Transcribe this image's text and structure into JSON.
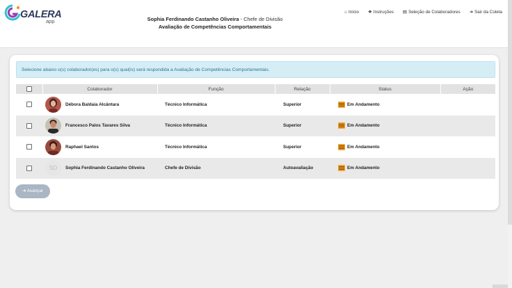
{
  "header": {
    "logo_text": "GALERA",
    "logo_sub": "app",
    "user_name": "Sophia Ferdinando Castanho Oliveira",
    "user_role": "Chefe de Divisão",
    "separator": "-",
    "subtitle": "Avaliação de Competências Comportamentais"
  },
  "nav": [
    {
      "label": "Início",
      "icon": "home-icon"
    },
    {
      "label": "Instruções",
      "icon": "help-circle-icon"
    },
    {
      "label": "Seleção de Colaboradores",
      "icon": "list-icon"
    },
    {
      "label": "Sair da Coleta",
      "icon": "logout-icon"
    }
  ],
  "info_message": "Selecione abaixo o(s) colaborador(es) para o(s) qual(is) será respondida a Avaliação de Competências Comportamentais.",
  "table": {
    "headers": [
      "",
      "Colaborador",
      "Função",
      "Relação",
      "Status",
      "Ação"
    ],
    "rows": [
      {
        "name": "Débora Baldaia Alcântara",
        "funcao": "Técnico Informática",
        "relacao": "Superior",
        "status": "Em Andamento",
        "avatar": "photo"
      },
      {
        "name": "Francesco Palos Tavares Silva",
        "funcao": "Técnico Informática",
        "relacao": "Superior",
        "status": "Em Andamento",
        "avatar": "photo"
      },
      {
        "name": "Raphael Santos",
        "funcao": "Técnico Informática",
        "relacao": "Superior",
        "status": "Em Andamento",
        "avatar": "photo"
      },
      {
        "name": "Sophia Ferdinando Castanho Oliveira",
        "funcao": "Chefe de Divisão",
        "relacao": "Autoavaliação",
        "status": "Em Andamento",
        "avatar": "initials",
        "initials": "SO"
      }
    ]
  },
  "advance_button": "Avançar",
  "colors": {
    "info_bg": "#d5eef6",
    "info_text": "#31708f",
    "status_icon": "#f2a12a",
    "button_bg": "#a9b6c3"
  }
}
